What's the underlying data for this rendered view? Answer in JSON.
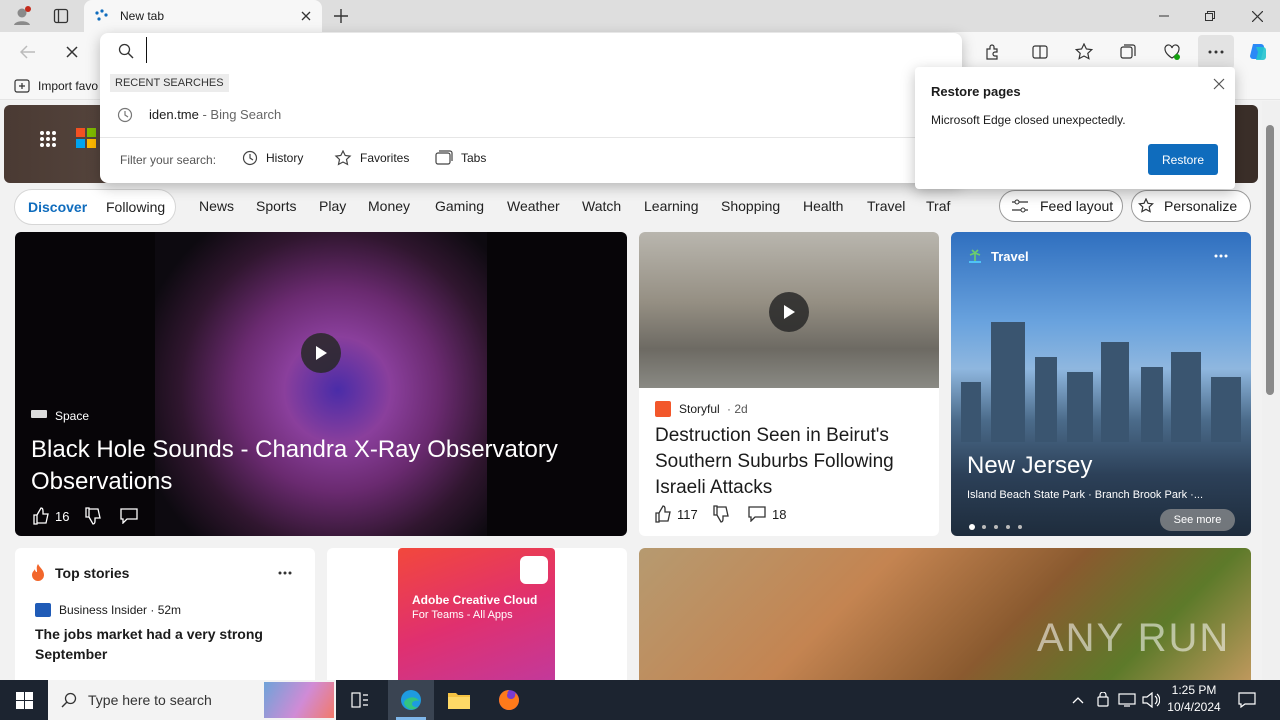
{
  "browser": {
    "tab_title": "New tab",
    "fav_import": "Import favo",
    "omnibox": {
      "recent_label": "RECENT SEARCHES",
      "recent_item": "iden.tme",
      "recent_suffix": " - Bing Search",
      "filter_label": "Filter your search:",
      "filters": [
        "History",
        "Favorites",
        "Tabs"
      ]
    },
    "restore": {
      "title": "Restore pages",
      "message": "Microsoft Edge closed unexpectedly.",
      "button": "Restore"
    }
  },
  "feed": {
    "tabs": [
      "Discover",
      "Following"
    ],
    "categories": [
      "News",
      "Sports",
      "Play",
      "Money",
      "Gaming",
      "Weather",
      "Watch",
      "Learning",
      "Shopping",
      "Health",
      "Travel",
      "Traf"
    ],
    "feed_layout": "Feed layout",
    "personalize": "Personalize",
    "main_card": {
      "source": "Space",
      "title": "Black Hole Sounds - Chandra X-Ray Observatory Observations",
      "likes": "16"
    },
    "beirut_card": {
      "source": "Storyful",
      "age": "· 2d",
      "title": "Destruction Seen in Beirut's Southern Suburbs Following Israeli Attacks",
      "likes": "117",
      "comments": "18"
    },
    "travel_card": {
      "label": "Travel",
      "title": "New Jersey",
      "subtitle": "Island Beach State Park · Branch Brook Park ·...",
      "see_more": "See more"
    },
    "top_stories": {
      "heading": "Top stories",
      "source": "Business Insider · 52m",
      "headline": "The jobs market had a very strong September"
    },
    "ad": {
      "title": "Adobe Creative Cloud",
      "subtitle": "For Teams - All Apps"
    },
    "watermark": "ANY RUN"
  },
  "taskbar": {
    "search_placeholder": "Type here to search",
    "time": "1:25 PM",
    "date": "10/4/2024"
  },
  "colors": {
    "accent": "#0f6cbd",
    "taskbar": "#1c2430"
  }
}
